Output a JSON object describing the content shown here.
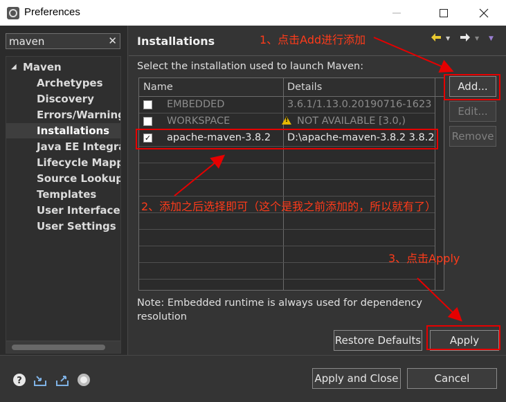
{
  "window": {
    "title": "Preferences"
  },
  "filter": {
    "value": "maven",
    "clear_glyph": "✕"
  },
  "tree": {
    "parent": "Maven",
    "children": [
      "Archetypes",
      "Discovery",
      "Errors/Warnings",
      "Installations",
      "Java EE Integrat",
      "Lifecycle Mappin",
      "Source Lookup",
      "Templates",
      "User Interface",
      "User Settings"
    ],
    "selected": "Installations"
  },
  "page": {
    "title": "Installations",
    "prompt": "Select the installation used to launch Maven:",
    "col_name": "Name",
    "col_details": "Details",
    "rows": [
      {
        "name": "EMBEDDED",
        "details": "3.6.1/1.13.0.20190716-1623",
        "checked": false,
        "disabled": true
      },
      {
        "name": "WORKSPACE",
        "details": "NOT AVAILABLE [3.0,)",
        "checked": false,
        "disabled": true,
        "warning": true
      },
      {
        "name": "apache-maven-3.8.2",
        "details": "D:\\apache-maven-3.8.2 3.8.2",
        "checked": true,
        "disabled": false
      }
    ],
    "note": "Note: Embedded runtime is always used for dependency resolution",
    "buttons": {
      "add": "Add...",
      "edit": "Edit...",
      "remove": "Remove",
      "restore": "Restore Defaults",
      "apply": "Apply"
    }
  },
  "footer": {
    "apply_close": "Apply and Close",
    "cancel": "Cancel"
  },
  "annotations": {
    "step1": "1、点击Add进行添加",
    "step2": "2、添加之后选择即可（这个是我之前添加的，所以就有了）",
    "step3": "3、点击Apply"
  },
  "colors": {
    "accent_red": "#e60000",
    "annotation_text": "#ff3b1a",
    "warning": "#e6b800"
  }
}
